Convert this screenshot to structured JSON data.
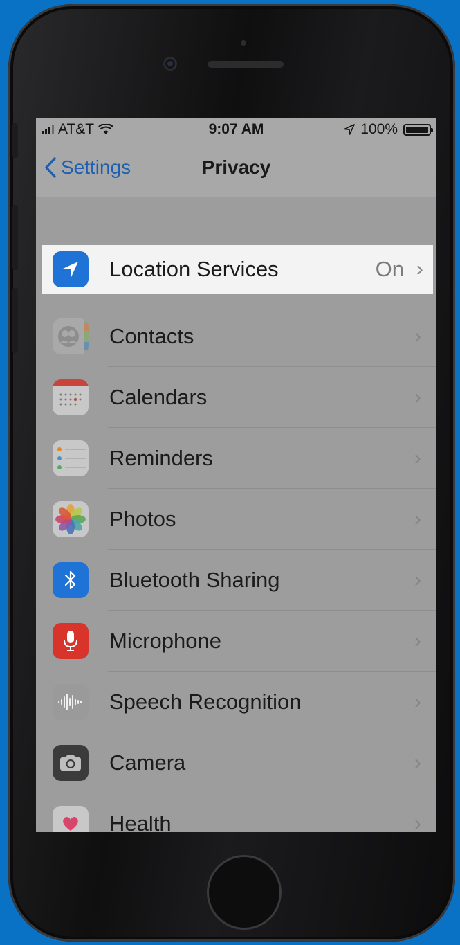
{
  "status_bar": {
    "carrier": "AT&T",
    "time": "9:07 AM",
    "battery": "100%"
  },
  "nav": {
    "back_label": "Settings",
    "title": "Privacy"
  },
  "rows": [
    {
      "label": "Location Services",
      "value": "On",
      "icon": "location-arrow-icon"
    },
    {
      "label": "Contacts",
      "icon": "contacts-icon"
    },
    {
      "label": "Calendars",
      "icon": "calendar-icon"
    },
    {
      "label": "Reminders",
      "icon": "reminders-icon"
    },
    {
      "label": "Photos",
      "icon": "photos-icon"
    },
    {
      "label": "Bluetooth Sharing",
      "icon": "bluetooth-icon"
    },
    {
      "label": "Microphone",
      "icon": "microphone-icon"
    },
    {
      "label": "Speech Recognition",
      "icon": "waveform-icon"
    },
    {
      "label": "Camera",
      "icon": "camera-icon"
    },
    {
      "label": "Health",
      "icon": "heart-icon"
    }
  ],
  "colors": {
    "background": "#0a72c5",
    "ios_blue": "#1f73d6",
    "highlight": "#f3f3f3"
  }
}
